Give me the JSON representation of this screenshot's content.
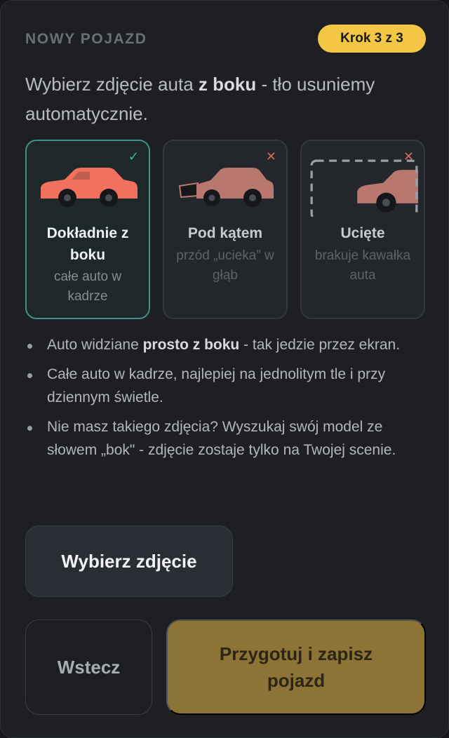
{
  "header": {
    "label": "NOWY POJAZD",
    "step_badge": "Krok 3 z 3"
  },
  "intro": {
    "part1": "Wybierz zdjęcie auta ",
    "bold": "z boku",
    "part2": " - tło usuniemy automatycznie."
  },
  "cards": [
    {
      "title": "Dokładnie z boku",
      "description": "całe auto w kadrze",
      "mark": "✓",
      "mark_icon": "check-icon",
      "car_color": "#f2705e"
    },
    {
      "title": "Pod kątem",
      "description": "przód „ucieka” w głąb",
      "mark": "✕",
      "mark_icon": "cross-icon",
      "car_color": "#b8776f"
    },
    {
      "title": "Ucięte",
      "description": "brakuje kawałka auta",
      "mark": "✕",
      "mark_icon": "cross-icon",
      "car_color": "#b8776f"
    }
  ],
  "tips": [
    {
      "part1": "Auto widziane ",
      "bold": "prosto z boku",
      "part2": " - tak jedzie przez ekran."
    },
    {
      "part1": "Całe auto w kadrze, najlepiej na jednolitym tle i przy dziennym świetle.",
      "bold": "",
      "part2": ""
    },
    {
      "part1": "Nie masz takiego zdjęcia? Wyszukaj swój model ze słowem „bok\" - zdjęcie zostaje tylko na Twojej scenie.",
      "bold": "",
      "part2": ""
    }
  ],
  "buttons": {
    "pick_photo": "Wybierz zdjęcie",
    "back": "Wstecz",
    "save": "Przygotuj i zapisz pojazd"
  },
  "colors": {
    "accent_yellow": "#f3c743",
    "good_border": "#3f9189",
    "check": "#3fb8a8",
    "cross": "#d76a5f",
    "save_button": "#8c7336"
  }
}
